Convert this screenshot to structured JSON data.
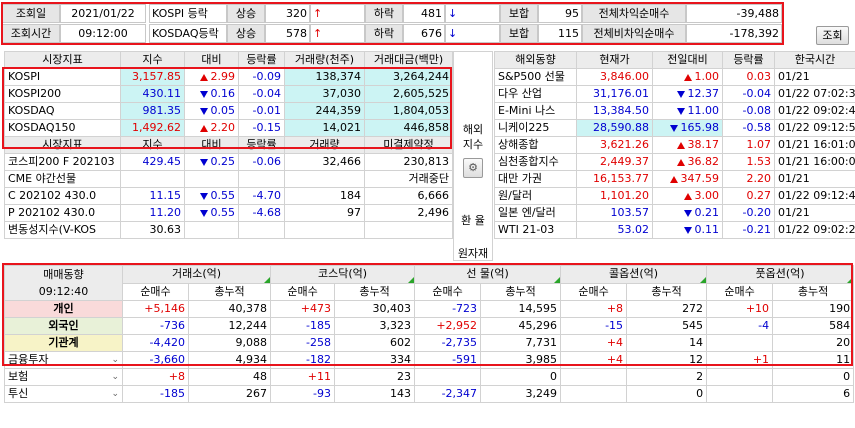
{
  "top": {
    "query_date_label": "조회일",
    "query_date": "2021/01/22",
    "query_time_label": "조회시간",
    "query_time": "09:12:00",
    "kospi_label": "KOSPI 등락",
    "kosdaq_label": "KOSDAQ등락",
    "up_label": "상승",
    "down_label": "하락",
    "flat_label": "보합",
    "kospi_up": "320",
    "kospi_up_arrow": "↑",
    "kospi_down": "481",
    "kospi_down_arrow": "↓",
    "kospi_flat": "95",
    "kosdaq_up": "578",
    "kosdaq_up_arrow": "↑",
    "kosdaq_down": "676",
    "kosdaq_down_arrow": "↓",
    "kosdaq_flat": "115",
    "total_arb_label": "전체차익순매수",
    "total_arb": "-39,488",
    "total_nonarb_label": "전체비차익순매수",
    "total_nonarb": "-178,392",
    "refresh_button": "조회"
  },
  "market": {
    "headers": [
      "시장지표",
      "지수",
      "대비",
      "등락률",
      "거래량(천주)",
      "거래대금(백만)"
    ],
    "rows": [
      {
        "name": "KOSPI",
        "index": "3,157.85",
        "dir": "up",
        "change": "2.99",
        "rate": "-0.09",
        "volume": "138,374",
        "amount": "3,264,244"
      },
      {
        "name": "KOSPI200",
        "index": "430.11",
        "dir": "dn",
        "change": "0.16",
        "rate": "-0.04",
        "volume": "37,030",
        "amount": "2,605,525"
      },
      {
        "name": "KOSDAQ",
        "index": "981.35",
        "dir": "dn",
        "change": "0.05",
        "rate": "-0.01",
        "volume": "244,359",
        "amount": "1,804,053"
      },
      {
        "name": "KOSDAQ150",
        "index": "1,492.62",
        "dir": "up",
        "change": "2.20",
        "rate": "-0.15",
        "volume": "14,021",
        "amount": "446,858"
      }
    ],
    "headers2": [
      "시장지표",
      "지수",
      "대비",
      "등락률",
      "거래량",
      "미결제약정"
    ],
    "rows2": [
      {
        "name": "코스피200 F 202103",
        "index": "429.45",
        "dir": "dn",
        "change": "0.25",
        "rate": "-0.06",
        "volume": "32,466",
        "amount": "230,813"
      },
      {
        "name": "CME 야간선물",
        "index": "",
        "dir": "",
        "change": "",
        "rate": "",
        "volume": "",
        "amount": "거래중단"
      },
      {
        "name": "C 202102 430.0",
        "index": "11.15",
        "dir": "dn",
        "change": "0.55",
        "rate": "-4.70",
        "volume": "184",
        "amount": "6,666"
      },
      {
        "name": "P 202102 430.0",
        "index": "11.20",
        "dir": "dn",
        "change": "0.55",
        "rate": "-4.68",
        "volume": "97",
        "amount": "2,496"
      },
      {
        "name": "변동성지수(V-KOS",
        "index": "30.63",
        "dir": "",
        "change": "",
        "rate": "",
        "volume": "",
        "amount": ""
      }
    ]
  },
  "side": {
    "overseas_label": "해외\n지수",
    "fx_label": "환 율",
    "raw_label": "원자재"
  },
  "overseas": {
    "headers": [
      "해외동향",
      "현재가",
      "전일대비",
      "등락률",
      "한국시간"
    ],
    "rows": [
      {
        "name": "S&P500 선물",
        "price": "3,846.00",
        "dir": "up",
        "change": "1.00",
        "rate": "0.03",
        "time": "01/21"
      },
      {
        "name": "다우 산업",
        "price": "31,176.01",
        "dir": "dn",
        "change": "12.37",
        "rate": "-0.04",
        "time": "01/22 07:02:36"
      },
      {
        "name": "E-Mini 나스",
        "price": "13,384.50",
        "dir": "dn",
        "change": "11.00",
        "rate": "-0.08",
        "time": "01/22 09:02:46"
      },
      {
        "name": "니케이225",
        "price": "28,590.88",
        "dir": "dn",
        "change": "165.98",
        "rate": "-0.58",
        "time": "01/22 09:12:50"
      },
      {
        "name": "상해종합",
        "price": "3,621.26",
        "dir": "up",
        "change": "38.17",
        "rate": "1.07",
        "time": "01/21 16:01:05"
      },
      {
        "name": "심천종합지수",
        "price": "2,449.37",
        "dir": "up",
        "change": "36.82",
        "rate": "1.53",
        "time": "01/21 16:00:03"
      },
      {
        "name": "대만 가권",
        "price": "16,153.77",
        "dir": "up",
        "change": "347.59",
        "rate": "2.20",
        "time": "01/21"
      },
      {
        "name": "원/달러",
        "price": "1,101.20",
        "dir": "up",
        "change": "3.00",
        "rate": "0.27",
        "time": "01/22 09:12:41"
      },
      {
        "name": "일본 엔/달러",
        "price": "103.57",
        "dir": "dn",
        "change": "0.21",
        "rate": "-0.20",
        "time": "01/21"
      },
      {
        "name": "WTI 21-03",
        "price": "53.02",
        "dir": "dn",
        "change": "0.11",
        "rate": "-0.21",
        "time": "01/22 09:02:25"
      }
    ]
  },
  "flow": {
    "title": "매매동향",
    "time": "09:12:40",
    "groups": [
      "거래소(억)",
      "코스닥(억)",
      "선 물(억)",
      "콜옵션(억)",
      "풋옵션(억)"
    ],
    "sub": [
      "순매수",
      "총누적"
    ],
    "rows": [
      {
        "name": "개인",
        "v": [
          "+5,146",
          "40,378",
          "+473",
          "30,403",
          "-723",
          "14,595",
          "+8",
          "272",
          "+10",
          "190"
        ]
      },
      {
        "name": "외국인",
        "v": [
          "-736",
          "12,244",
          "-185",
          "3,323",
          "+2,952",
          "45,296",
          "-15",
          "545",
          "-4",
          "584"
        ]
      },
      {
        "name": "기관계",
        "v": [
          "-4,420",
          "9,088",
          "-258",
          "602",
          "-2,735",
          "7,731",
          "+4",
          "14",
          "",
          "20"
        ]
      },
      {
        "name": "금융투자",
        "v": [
          "-3,660",
          "4,934",
          "-182",
          "334",
          "-591",
          "3,985",
          "+4",
          "12",
          "+1",
          "11"
        ]
      },
      {
        "name": "보험",
        "v": [
          "+8",
          "48",
          "+11",
          "23",
          "",
          "0",
          "",
          "2",
          "",
          "0"
        ]
      },
      {
        "name": "투신",
        "v": [
          "-185",
          "267",
          "-93",
          "143",
          "-2,347",
          "3,249",
          "",
          "0",
          "",
          "6"
        ]
      }
    ]
  }
}
